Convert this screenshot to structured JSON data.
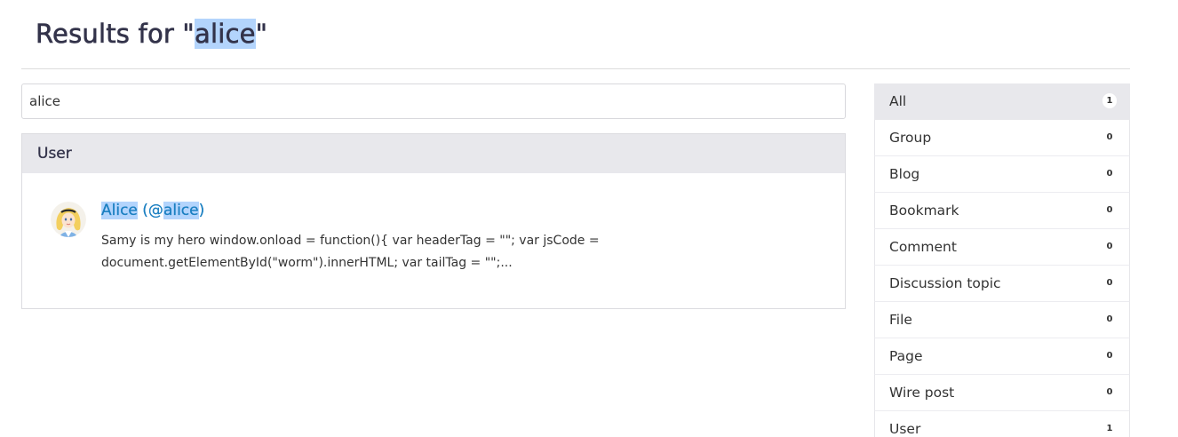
{
  "page": {
    "title_prefix": "Results for \"",
    "title_query": "alice",
    "title_suffix": "\""
  },
  "search": {
    "value": "alice"
  },
  "results": {
    "section_label": "User",
    "items": [
      {
        "name": "Alice",
        "handle_open": " (@",
        "handle": "alice",
        "handle_close": ")",
        "avatar_icon": "alice-avatar-icon",
        "description": "Samy is my hero window.onload = function(){ var headerTag = \"\"; var jsCode = document.getElementById(\"worm\").innerHTML; var tailTag = \"\";..."
      }
    ]
  },
  "types": [
    {
      "label": "All",
      "count": "1",
      "active": true
    },
    {
      "label": "Group",
      "count": "0"
    },
    {
      "label": "Blog",
      "count": "0"
    },
    {
      "label": "Bookmark",
      "count": "0"
    },
    {
      "label": "Comment",
      "count": "0"
    },
    {
      "label": "Discussion topic",
      "count": "0"
    },
    {
      "label": "File",
      "count": "0"
    },
    {
      "label": "Page",
      "count": "0"
    },
    {
      "label": "Wire post",
      "count": "0"
    },
    {
      "label": "User",
      "count": "1"
    }
  ],
  "colors": {
    "link": "#1a7fc1",
    "active_bg": "#e8e8ec",
    "highlight": "#b3d4fc"
  }
}
